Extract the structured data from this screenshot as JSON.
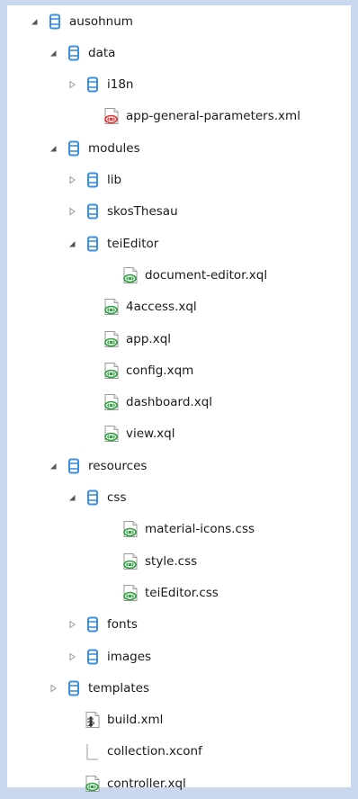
{
  "colors": {
    "folder_blue": "#3b8fe0",
    "xml_red": "#e2332f",
    "xql_green": "#2e9e3e",
    "expanded_arrow": "#555555",
    "collapsed_arrow": "#9a9a9a"
  },
  "tree": [
    {
      "label": "ausohnum",
      "level": 0,
      "kind": "folder",
      "state": "expanded"
    },
    {
      "label": "data",
      "level": 1,
      "kind": "folder",
      "state": "expanded"
    },
    {
      "label": "i18n",
      "level": 2,
      "kind": "folder",
      "state": "collapsed"
    },
    {
      "label": "app-general-parameters.xml",
      "level": 3,
      "kind": "xml-file",
      "state": "leaf"
    },
    {
      "label": "modules",
      "level": 1,
      "kind": "folder",
      "state": "expanded"
    },
    {
      "label": "lib",
      "level": 2,
      "kind": "folder",
      "state": "collapsed"
    },
    {
      "label": "skosThesau",
      "level": 2,
      "kind": "folder",
      "state": "collapsed"
    },
    {
      "label": "teiEditor",
      "level": 2,
      "kind": "folder",
      "state": "expanded"
    },
    {
      "label": "document-editor.xql",
      "level": 4,
      "kind": "xql-file",
      "state": "leaf"
    },
    {
      "label": "4access.xql",
      "level": 3,
      "kind": "xql-file",
      "state": "leaf"
    },
    {
      "label": "app.xql",
      "level": 3,
      "kind": "xql-file",
      "state": "leaf"
    },
    {
      "label": "config.xqm",
      "level": 3,
      "kind": "xql-file",
      "state": "leaf"
    },
    {
      "label": "dashboard.xql",
      "level": 3,
      "kind": "xql-file",
      "state": "leaf"
    },
    {
      "label": "view.xql",
      "level": 3,
      "kind": "xql-file",
      "state": "leaf"
    },
    {
      "label": "resources",
      "level": 1,
      "kind": "folder",
      "state": "expanded"
    },
    {
      "label": "css",
      "level": 2,
      "kind": "folder",
      "state": "expanded"
    },
    {
      "label": "material-icons.css",
      "level": 4,
      "kind": "xql-file",
      "state": "leaf"
    },
    {
      "label": "style.css",
      "level": 4,
      "kind": "xql-file",
      "state": "leaf"
    },
    {
      "label": "teiEditor.css",
      "level": 4,
      "kind": "xql-file",
      "state": "leaf"
    },
    {
      "label": "fonts",
      "level": 2,
      "kind": "folder",
      "state": "collapsed"
    },
    {
      "label": "images",
      "level": 2,
      "kind": "folder",
      "state": "collapsed"
    },
    {
      "label": "templates",
      "level": 1,
      "kind": "folder",
      "state": "collapsed"
    },
    {
      "label": "build.xml",
      "level": 2,
      "kind": "ant-file",
      "state": "leaf"
    },
    {
      "label": "collection.xconf",
      "level": 2,
      "kind": "blank-file",
      "state": "leaf"
    },
    {
      "label": "controller.xql",
      "level": 2,
      "kind": "xql-file",
      "state": "leaf"
    }
  ]
}
